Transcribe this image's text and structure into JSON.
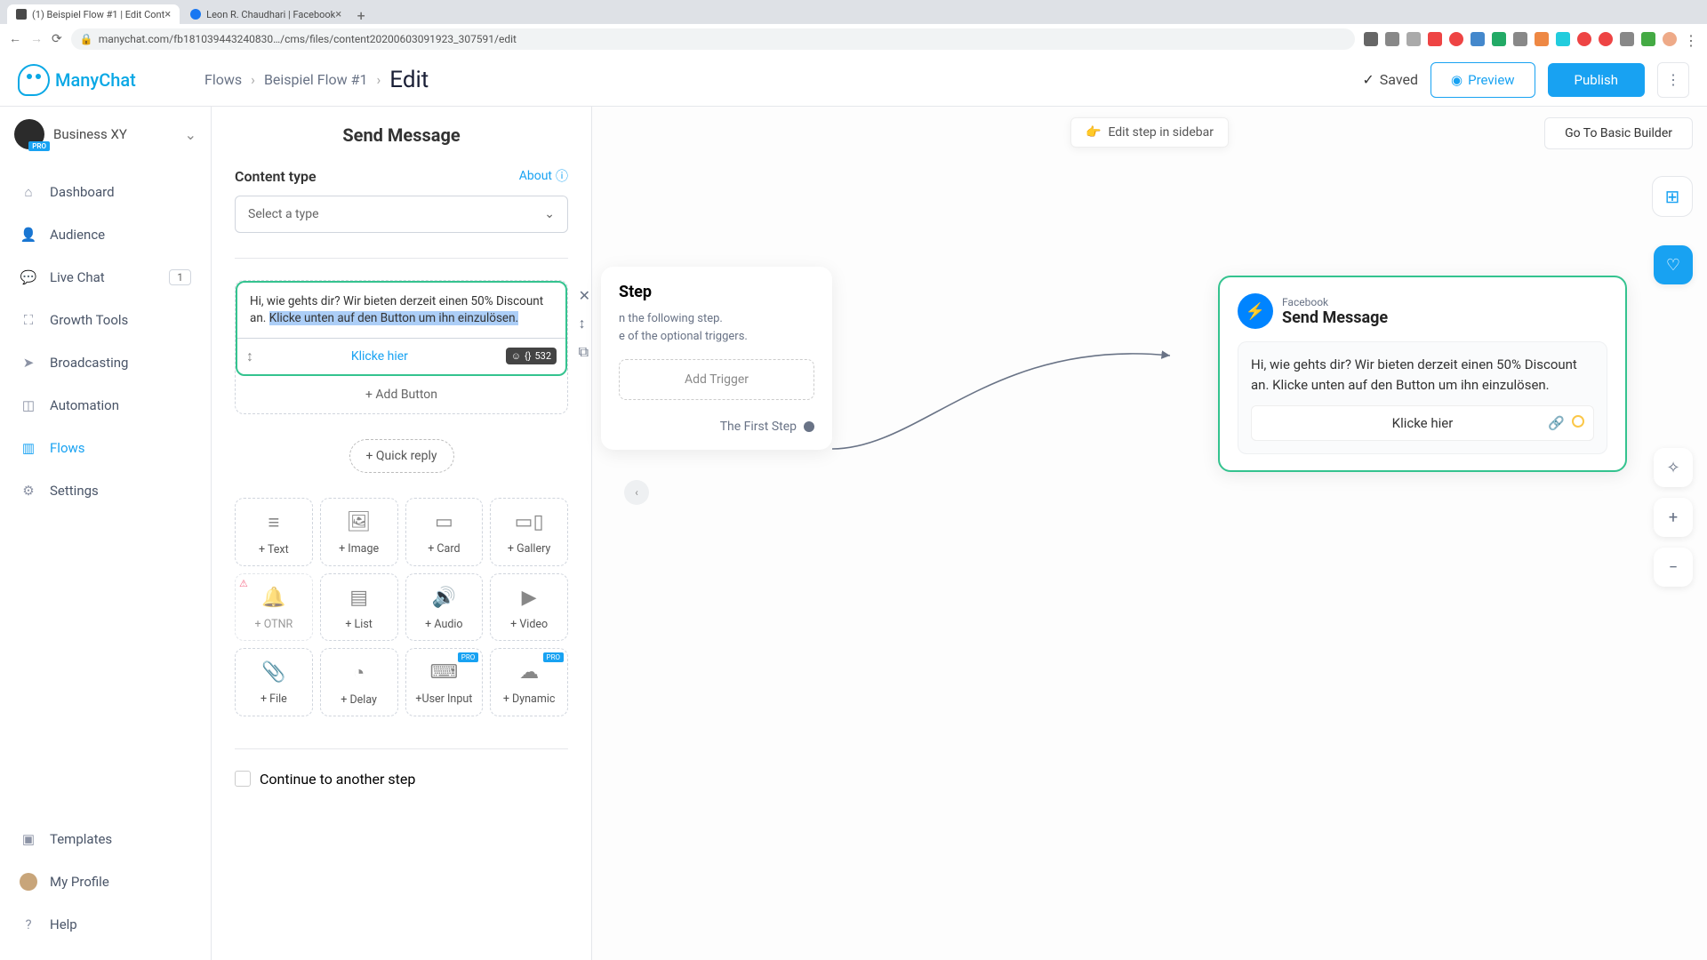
{
  "browser": {
    "tabs": [
      {
        "title": "(1) Beispiel Flow #1 | Edit Cont"
      },
      {
        "title": "Leon R. Chaudhari | Facebook"
      }
    ],
    "url": "manychat.com/fb181039443240830…/cms/files/content20200603091923_307591/edit"
  },
  "brand": {
    "name": "ManyChat"
  },
  "business": {
    "name": "Business XY",
    "pro_badge": "PRO"
  },
  "nav": {
    "items": [
      {
        "id": "dashboard",
        "label": "Dashboard"
      },
      {
        "id": "audience",
        "label": "Audience"
      },
      {
        "id": "livechat",
        "label": "Live Chat",
        "badge": "1"
      },
      {
        "id": "growth",
        "label": "Growth Tools"
      },
      {
        "id": "broadcasting",
        "label": "Broadcasting"
      },
      {
        "id": "automation",
        "label": "Automation"
      },
      {
        "id": "flows",
        "label": "Flows",
        "active": true
      },
      {
        "id": "settings",
        "label": "Settings"
      }
    ],
    "bottom": [
      {
        "id": "templates",
        "label": "Templates"
      },
      {
        "id": "profile",
        "label": "My Profile"
      },
      {
        "id": "help",
        "label": "Help"
      }
    ]
  },
  "breadcrumbs": {
    "root": "Flows",
    "flow_name": "Beispiel Flow #1",
    "current": "Edit"
  },
  "topbar": {
    "saved": "Saved",
    "preview": "Preview",
    "publish": "Publish"
  },
  "canvas": {
    "notice": "Edit step in sidebar",
    "basic_switch": "Go To Basic Builder",
    "start": {
      "title": "Step",
      "line1": "n the following step.",
      "line2": "e of the optional triggers.",
      "add_trigger": "Add Trigger",
      "port_label": "The First Step"
    },
    "send_msg": {
      "platform": "Facebook",
      "title": "Send Message",
      "body": "Hi, wie gehts dir? Wir bieten derzeit einen 50% Discount an. Klicke unten auf den Button um ihn einzulösen.",
      "button_label": "Klicke hier"
    }
  },
  "editor": {
    "panel_title": "Send Message",
    "content_type_label": "Content type",
    "about": "About",
    "select_placeholder": "Select a type",
    "message": {
      "text_part1": "Hi, wie gehts dir? Wir bieten derzeit einen 50% Discount an. ",
      "text_selected": "Klicke unten auf den Button um ihn einzulösen.",
      "btn_label": "Klicke hier",
      "char_counter": "532"
    },
    "add_button": "+ Add Button",
    "quick_reply": "+ Quick reply",
    "tiles": [
      {
        "label": "+ Text"
      },
      {
        "label": "+ Image"
      },
      {
        "label": "+ Card"
      },
      {
        "label": "+ Gallery"
      },
      {
        "label": "+ OTNR",
        "warn": true,
        "disabled": true
      },
      {
        "label": "+ List"
      },
      {
        "label": "+ Audio"
      },
      {
        "label": "+ Video"
      },
      {
        "label": "+ File"
      },
      {
        "label": "+ Delay"
      },
      {
        "label": "+User Input",
        "pro": true
      },
      {
        "label": "+ Dynamic",
        "pro": true
      }
    ],
    "continue_label": "Continue to another step"
  }
}
